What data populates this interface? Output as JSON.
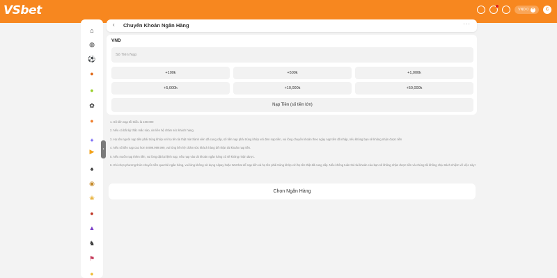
{
  "header": {
    "logo": "VSbet",
    "currency": "VND 0",
    "avatar": "C",
    "icons": [
      "wallet-icon",
      "bell-icon",
      "headset-icon"
    ]
  },
  "sidebar": {
    "icons": [
      "home-icon",
      "globe-icon",
      "soccer-icon",
      "basketball-icon",
      "tennis-icon",
      "lottery-icon",
      "volleyball-icon",
      "fish-icon",
      "video-icon",
      "spade-icon",
      "poker-chip-icon",
      "slot-icon",
      "cockfight-icon",
      "esports-icon",
      "horse-icon",
      "flag-icon",
      "coin-icon"
    ]
  },
  "page": {
    "back_label": "‹",
    "title": "Chuyển Khoản Ngân Hàng",
    "more_label": "···"
  },
  "deposit": {
    "currency_label": "VND",
    "amount_placeholder": "Số Tiền Nạp",
    "quick_amounts": [
      "+100k",
      "+500k",
      "+1,000k",
      "+5,000k",
      "+10,000k",
      "+50,000k"
    ],
    "submit_label": "Nạp Tiền (số tiền lớn)"
  },
  "notes": [
    "1. Số tiền nạp tối thiểu là 100.000",
    "2. Nếu có bất kỳ thắc mắc nào, xin liên hệ chăm sóc khách hàng.",
    "3. Họ tên người nạp tiền phải trùng khớp với họ tên tài thật mà thành viên đã cung cấp, số tiền nạp phải trùng khớp với đơn nạp tiền, vui lòng chuyển khoản theo ngày nạp tiền đã nhập, nếu không bạn sẽ không nhận được tiền",
    "4. Nếu số tiền nạp cao hơn 9.999.999.999, vui lòng liên hệ chăm sóc khách hàng để nhận tài khoản nạp tiền.",
    "5. Nếu muốn nạp thêm tiền, vui lòng đặt lại lệnh nạp, nếu nạp vào tài khoản ngân hàng cũ sẽ không nhận được.",
    "6. Khi chọn phương thức chuyển tiền qua thẻ ngân hàng, vui lòng không sử dụng Alipay hoặc WeChat để nạp tiền và họ tên phải trùng khớp với họ tên thật đã cung cấp. Nếu không tuân thủ tài khoản của bạn sẽ không nhận được tiền và chúng tôi không chịu trách nhiệm về việc này!"
  ],
  "choose_bank_label": "Chọn Ngân Hàng",
  "colors": {
    "brand": "#f7871f",
    "background": "#f3f3f3",
    "button": "#f2f2f2"
  }
}
